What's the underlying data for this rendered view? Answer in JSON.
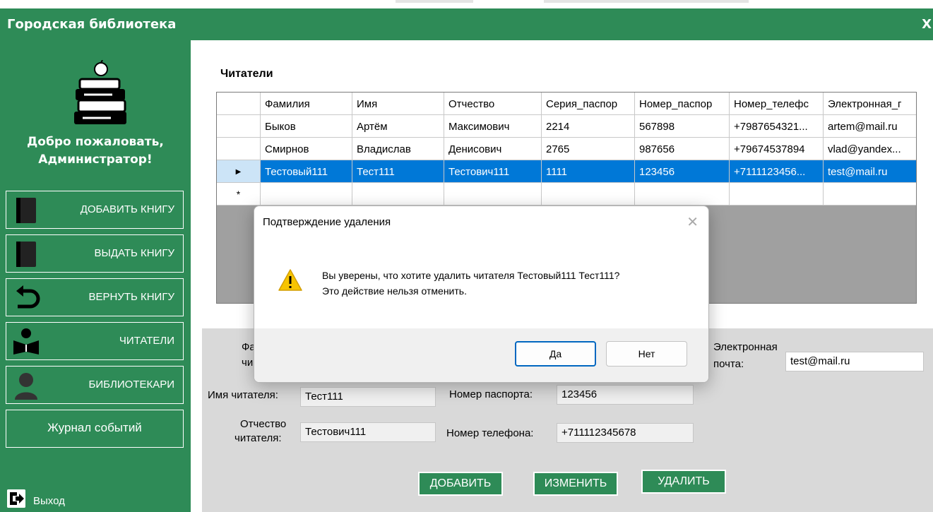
{
  "window": {
    "title": "Городская библиотека",
    "close_label": "X"
  },
  "sidebar": {
    "welcome_line1": "Добро пожаловать,",
    "welcome_line2": "Администратор!",
    "items": [
      {
        "label": "ДОБАВИТЬ КНИГУ",
        "icon": "book-icon"
      },
      {
        "label": "ВЫДАТЬ КНИГУ",
        "icon": "book-icon"
      },
      {
        "label": "ВЕРНУТЬ КНИГУ",
        "icon": "return-arrow-icon"
      },
      {
        "label": "ЧИТАТЕЛИ",
        "icon": "reader-icon"
      },
      {
        "label": "БИБЛИОТЕКАРИ",
        "icon": "user-icon"
      },
      {
        "label": "Журнал событий",
        "icon": ""
      }
    ],
    "logout_label": "Выход"
  },
  "readers": {
    "title": "Читатели",
    "columns": [
      "Фамилия",
      "Имя",
      "Отчество",
      "Серия_паспор",
      "Номер_паспор",
      "Номер_телефс",
      "Электронная_г"
    ],
    "rows": [
      [
        "Быков",
        "Артём",
        "Максимович",
        "2214",
        "567898",
        "+7987654321...",
        "artem@mail.ru"
      ],
      [
        "Смирнов",
        "Владислав",
        "Денисович",
        "2765",
        "987656",
        "+79674537894",
        "vlad@yandex..."
      ],
      [
        "Тестовый111",
        "Тест111",
        "Тестович111",
        "1111",
        "123456",
        "+7111123456...",
        "test@mail.ru"
      ]
    ],
    "selected_row_marker": "▶",
    "new_row_marker": "*"
  },
  "form": {
    "surname_label_a": "Фа",
    "surname_label_b": "чи",
    "name_label": "Имя читателя:",
    "name_value": "Тест111",
    "patronymic_label_1": "Отчество",
    "patronymic_label_2": "читателя:",
    "patronymic_value": "Тестович111",
    "passport_label": "Номер паспорта:",
    "passport_value": "123456",
    "phone_label": "Номер телефона:",
    "phone_value": "+711112345678",
    "email_label_1": "Электронная",
    "email_label_2": "почта:",
    "email_value": "test@mail.ru",
    "add_label": "ДОБАВИТЬ",
    "edit_label": "ИЗМЕНИТЬ",
    "delete_label": "УДАЛИТЬ"
  },
  "dialog": {
    "title": "Подтверждение удаления",
    "message_line1": "Вы уверены, что хотите удалить читателя Тестовый111 Тест111?",
    "message_line2": "Это действие нельзя отменить.",
    "yes_label": "Да",
    "no_label": "Нет",
    "close_label": "✕",
    "icon": "warning-icon"
  },
  "colors": {
    "primary_green": "#2e8b57",
    "selection_blue": "#0078d7",
    "form_gray": "#d9d9d9",
    "grid_gray": "#a0a0a0"
  }
}
